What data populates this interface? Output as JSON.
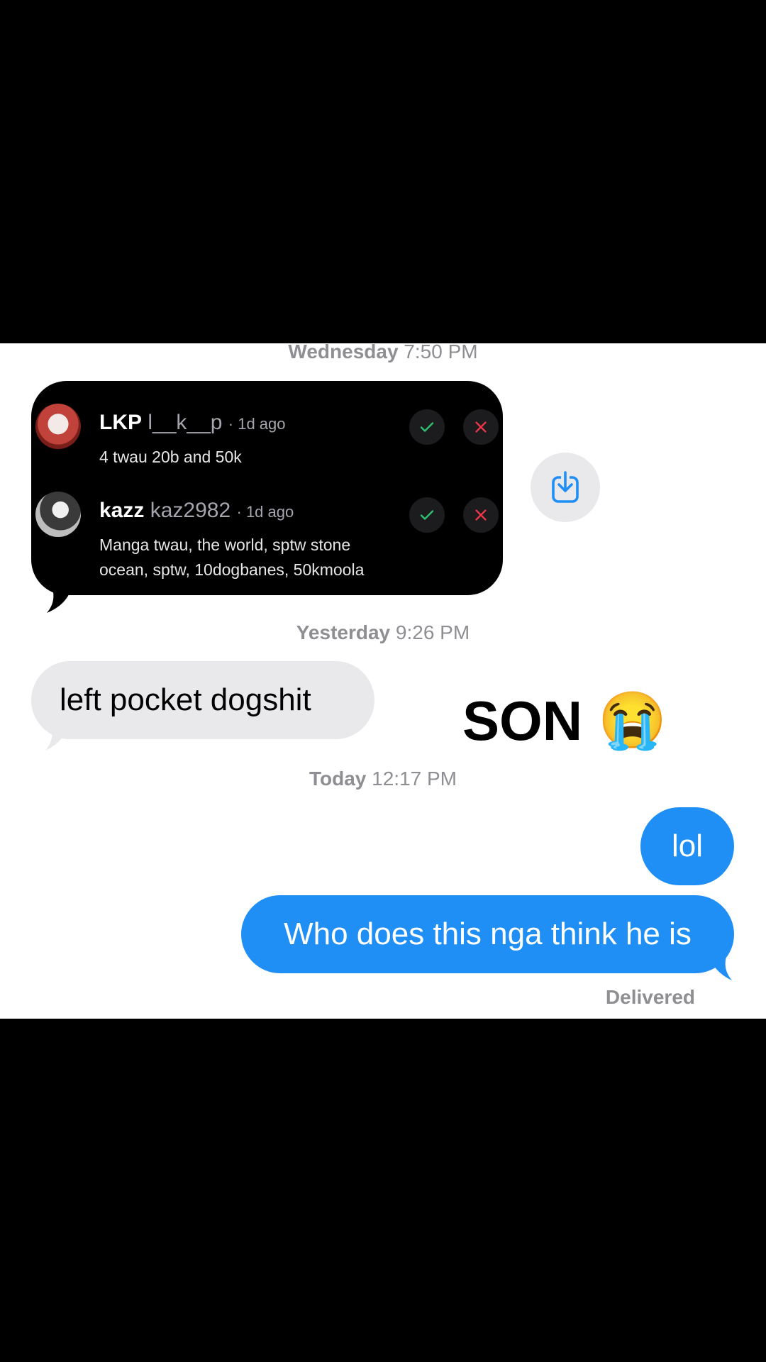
{
  "thread": {
    "timestamps": [
      {
        "day": "Wednesday",
        "time": "7:50 PM"
      },
      {
        "day": "Yesterday",
        "time": "9:26 PM"
      },
      {
        "day": "Today",
        "time": "12:17 PM"
      }
    ],
    "embedded_screenshot": {
      "requests": [
        {
          "display_name": "LKP",
          "handle": "l__k__p",
          "age": "· 1d ago",
          "message": "4 twau 20b and 50k",
          "accept_icon": "check-icon",
          "decline_icon": "close-icon"
        },
        {
          "display_name": "kazz",
          "handle": "kaz2982",
          "age": "· 1d ago",
          "message": "Manga twau, the world, sptw stone ocean, sptw, 10dogbanes, 50kmoola",
          "accept_icon": "check-icon",
          "decline_icon": "close-icon"
        }
      ]
    },
    "save_icon": "download-icon",
    "incoming_message": "left pocket dogshit",
    "caption": {
      "text": "SON",
      "emoji": "😭"
    },
    "outgoing_messages": [
      "lol",
      "Who does this nga think he is"
    ],
    "status": "Delivered"
  },
  "colors": {
    "outgoing_bubble": "#1f8ff5",
    "incoming_bubble": "#e9e9eb",
    "timestamp_gray": "#8e8e93",
    "accept_green": "#2fbf71",
    "decline_red": "#f0354b"
  }
}
